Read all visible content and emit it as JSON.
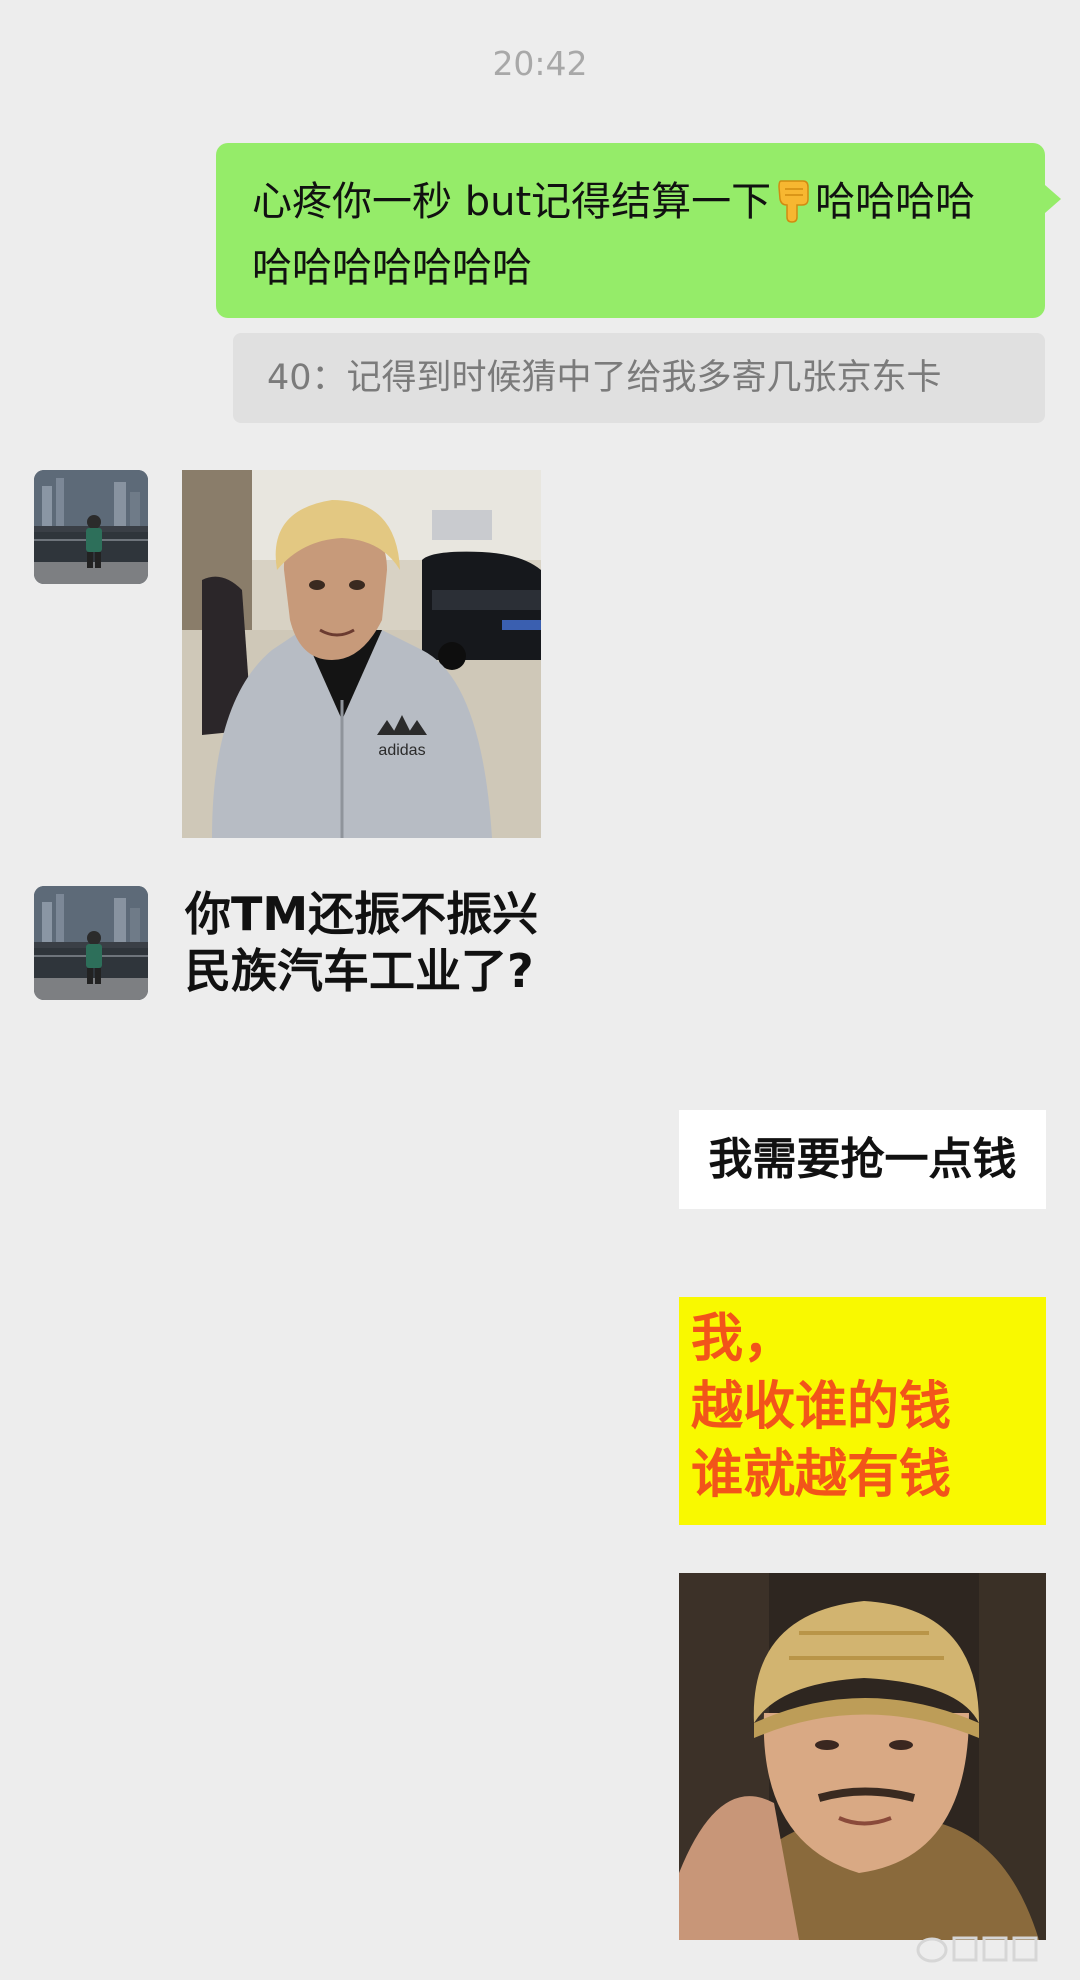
{
  "chat": {
    "timestamp": "20:42",
    "outgoing_message": {
      "text_before_emoji": "心疼你一秒 but记得结算一下",
      "emoji": "backhand-index-pointing-down",
      "text_after_emoji": "哈哈哈哈哈哈哈哈哈哈哈"
    },
    "quoted_reply": "40：记得到时候猜中了给我多寄几张京东卡",
    "incoming_sticker_caption": "你TM还振不振兴民族汽车工业了?",
    "outgoing_text_sticker": "我需要抢一点钱",
    "outgoing_yellow_sticker": {
      "line1": "我，",
      "line2": "越收谁的钱",
      "line3": "谁就越有钱"
    },
    "photo_shirt_logo_text": "adidas"
  },
  "colors": {
    "background": "#ededed",
    "outgoing_bubble": "#95ec69",
    "quote_box": "#e0e0e0",
    "yellow_sticker_bg": "#f9f900",
    "yellow_sticker_text": "#f2541a"
  }
}
